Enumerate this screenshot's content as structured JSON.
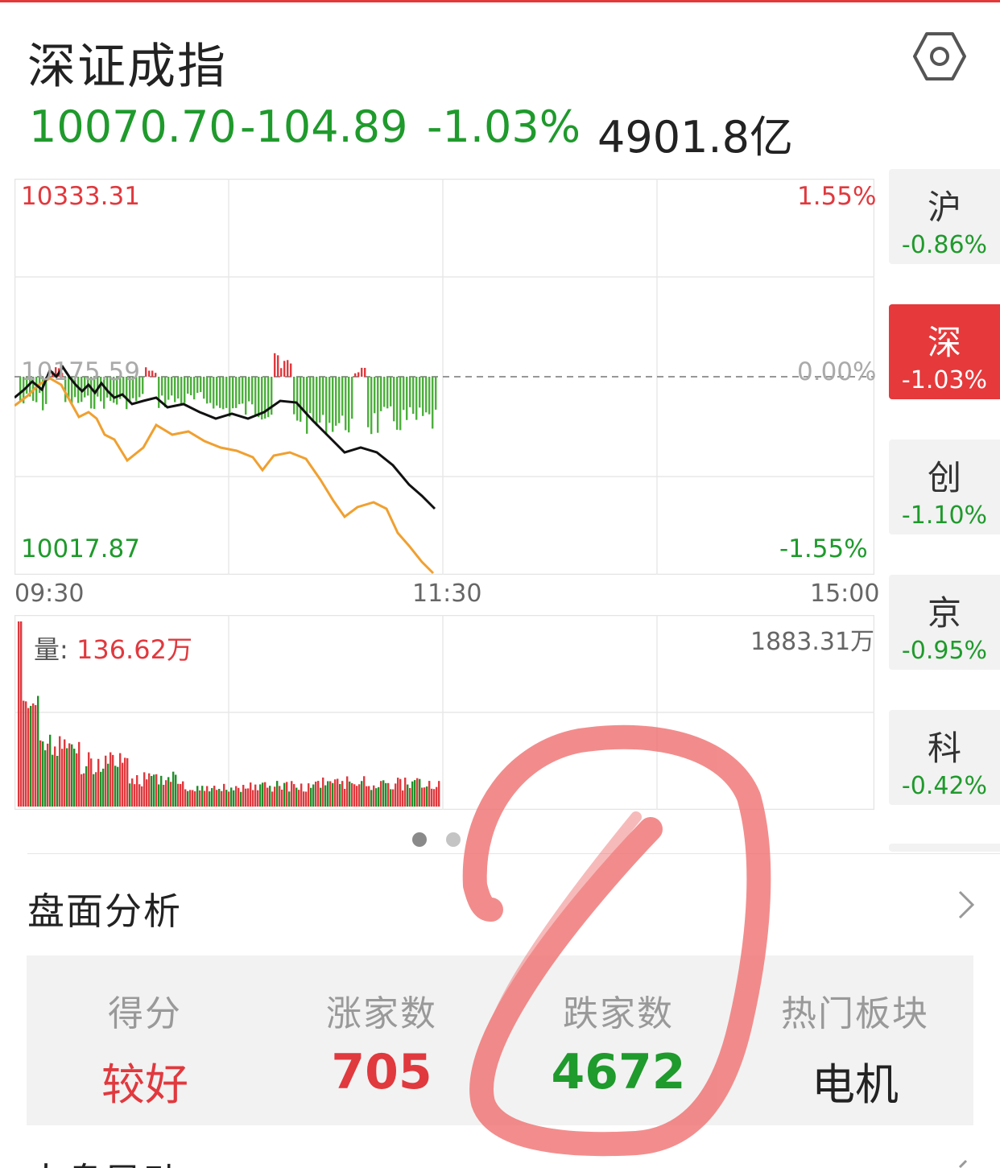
{
  "header": {
    "title": "深证成指",
    "settings_icon": "hexagon-settings-icon"
  },
  "quote": {
    "price": "10070.70",
    "change": "-104.89",
    "change_pct": "-1.03%",
    "turnover": "4901.8亿"
  },
  "intraday": {
    "high_price": "10333.31",
    "low_price": "10017.87",
    "prev_close_price": "10175.59",
    "high_pct": "1.55%",
    "zero_pct": "0.00%",
    "low_pct": "-1.55%",
    "time_ticks": [
      "09:30",
      "11:30",
      "15:00"
    ]
  },
  "volume": {
    "label": "量:",
    "current": "136.62万",
    "max": "1883.31万"
  },
  "side_tabs": [
    {
      "name": "沪",
      "pct": "-0.86%",
      "active": false
    },
    {
      "name": "深",
      "pct": "-1.03%",
      "active": true
    },
    {
      "name": "创",
      "pct": "-1.10%",
      "active": false
    },
    {
      "name": "京",
      "pct": "-0.95%",
      "active": false
    },
    {
      "name": "科",
      "pct": "-0.42%",
      "active": false
    }
  ],
  "pager": {
    "count": 2,
    "active": 0
  },
  "analysis": {
    "title": "盘面分析",
    "stats": [
      {
        "label": "得分",
        "value": "较好",
        "color": "#e0393e"
      },
      {
        "label": "涨家数",
        "value": "705",
        "color": "#e0393e"
      },
      {
        "label": "跌家数",
        "value": "4672",
        "color": "#1f9a2c"
      },
      {
        "label": "热门板块",
        "value": "电机",
        "color": "#222222"
      }
    ]
  },
  "next_section": {
    "title": "大盘异动"
  },
  "colors": {
    "up": "#e0393e",
    "down": "#1f9a2c",
    "index_line": "#111111",
    "avg_line": "#f0a030",
    "annotation": "#f07070"
  }
}
